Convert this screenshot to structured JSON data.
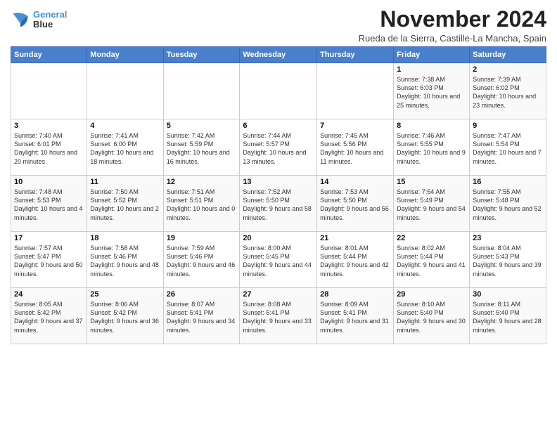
{
  "logo": {
    "line1": "General",
    "line2": "Blue"
  },
  "title": "November 2024",
  "subtitle": "Rueda de la Sierra, Castille-La Mancha, Spain",
  "weekdays": [
    "Sunday",
    "Monday",
    "Tuesday",
    "Wednesday",
    "Thursday",
    "Friday",
    "Saturday"
  ],
  "weeks": [
    [
      {
        "day": "",
        "info": ""
      },
      {
        "day": "",
        "info": ""
      },
      {
        "day": "",
        "info": ""
      },
      {
        "day": "",
        "info": ""
      },
      {
        "day": "",
        "info": ""
      },
      {
        "day": "1",
        "info": "Sunrise: 7:38 AM\nSunset: 6:03 PM\nDaylight: 10 hours and 25 minutes."
      },
      {
        "day": "2",
        "info": "Sunrise: 7:39 AM\nSunset: 6:02 PM\nDaylight: 10 hours and 23 minutes."
      }
    ],
    [
      {
        "day": "3",
        "info": "Sunrise: 7:40 AM\nSunset: 6:01 PM\nDaylight: 10 hours and 20 minutes."
      },
      {
        "day": "4",
        "info": "Sunrise: 7:41 AM\nSunset: 6:00 PM\nDaylight: 10 hours and 18 minutes."
      },
      {
        "day": "5",
        "info": "Sunrise: 7:42 AM\nSunset: 5:59 PM\nDaylight: 10 hours and 16 minutes."
      },
      {
        "day": "6",
        "info": "Sunrise: 7:44 AM\nSunset: 5:57 PM\nDaylight: 10 hours and 13 minutes."
      },
      {
        "day": "7",
        "info": "Sunrise: 7:45 AM\nSunset: 5:56 PM\nDaylight: 10 hours and 11 minutes."
      },
      {
        "day": "8",
        "info": "Sunrise: 7:46 AM\nSunset: 5:55 PM\nDaylight: 10 hours and 9 minutes."
      },
      {
        "day": "9",
        "info": "Sunrise: 7:47 AM\nSunset: 5:54 PM\nDaylight: 10 hours and 7 minutes."
      }
    ],
    [
      {
        "day": "10",
        "info": "Sunrise: 7:48 AM\nSunset: 5:53 PM\nDaylight: 10 hours and 4 minutes."
      },
      {
        "day": "11",
        "info": "Sunrise: 7:50 AM\nSunset: 5:52 PM\nDaylight: 10 hours and 2 minutes."
      },
      {
        "day": "12",
        "info": "Sunrise: 7:51 AM\nSunset: 5:51 PM\nDaylight: 10 hours and 0 minutes."
      },
      {
        "day": "13",
        "info": "Sunrise: 7:52 AM\nSunset: 5:50 PM\nDaylight: 9 hours and 58 minutes."
      },
      {
        "day": "14",
        "info": "Sunrise: 7:53 AM\nSunset: 5:50 PM\nDaylight: 9 hours and 56 minutes."
      },
      {
        "day": "15",
        "info": "Sunrise: 7:54 AM\nSunset: 5:49 PM\nDaylight: 9 hours and 54 minutes."
      },
      {
        "day": "16",
        "info": "Sunrise: 7:55 AM\nSunset: 5:48 PM\nDaylight: 9 hours and 52 minutes."
      }
    ],
    [
      {
        "day": "17",
        "info": "Sunrise: 7:57 AM\nSunset: 5:47 PM\nDaylight: 9 hours and 50 minutes."
      },
      {
        "day": "18",
        "info": "Sunrise: 7:58 AM\nSunset: 5:46 PM\nDaylight: 9 hours and 48 minutes."
      },
      {
        "day": "19",
        "info": "Sunrise: 7:59 AM\nSunset: 5:46 PM\nDaylight: 9 hours and 46 minutes."
      },
      {
        "day": "20",
        "info": "Sunrise: 8:00 AM\nSunset: 5:45 PM\nDaylight: 9 hours and 44 minutes."
      },
      {
        "day": "21",
        "info": "Sunrise: 8:01 AM\nSunset: 5:44 PM\nDaylight: 9 hours and 42 minutes."
      },
      {
        "day": "22",
        "info": "Sunrise: 8:02 AM\nSunset: 5:44 PM\nDaylight: 9 hours and 41 minutes."
      },
      {
        "day": "23",
        "info": "Sunrise: 8:04 AM\nSunset: 5:43 PM\nDaylight: 9 hours and 39 minutes."
      }
    ],
    [
      {
        "day": "24",
        "info": "Sunrise: 8:05 AM\nSunset: 5:42 PM\nDaylight: 9 hours and 37 minutes."
      },
      {
        "day": "25",
        "info": "Sunrise: 8:06 AM\nSunset: 5:42 PM\nDaylight: 9 hours and 36 minutes."
      },
      {
        "day": "26",
        "info": "Sunrise: 8:07 AM\nSunset: 5:41 PM\nDaylight: 9 hours and 34 minutes."
      },
      {
        "day": "27",
        "info": "Sunrise: 8:08 AM\nSunset: 5:41 PM\nDaylight: 9 hours and 33 minutes."
      },
      {
        "day": "28",
        "info": "Sunrise: 8:09 AM\nSunset: 5:41 PM\nDaylight: 9 hours and 31 minutes."
      },
      {
        "day": "29",
        "info": "Sunrise: 8:10 AM\nSunset: 5:40 PM\nDaylight: 9 hours and 30 minutes."
      },
      {
        "day": "30",
        "info": "Sunrise: 8:11 AM\nSunset: 5:40 PM\nDaylight: 9 hours and 28 minutes."
      }
    ]
  ]
}
